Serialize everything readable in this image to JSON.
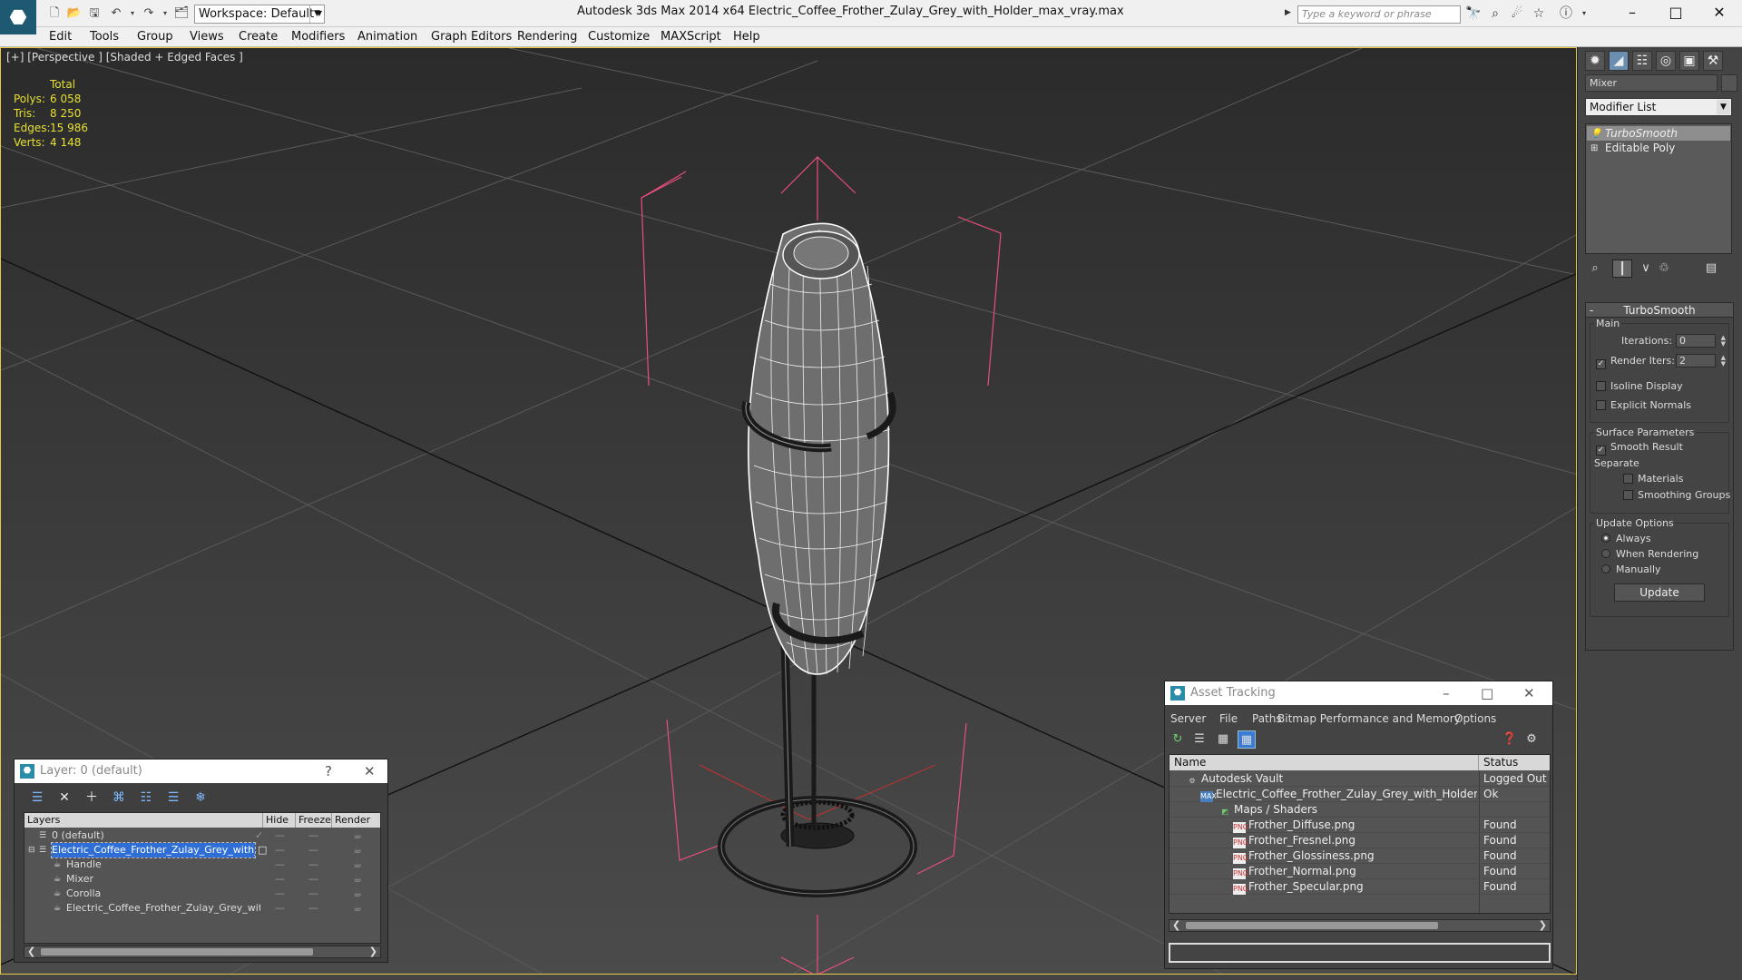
{
  "titlebar": {
    "app_icon": "3ds-max-logo-icon",
    "workspace": "Workspace: Default",
    "title": "Autodesk 3ds Max  2014 x64       Electric_Coffee_Frother_Zulay_Grey_with_Holder_max_vray.max",
    "search_placeholder": "Type a keyword or phrase"
  },
  "menu": [
    "Edit",
    "Tools",
    "Group",
    "Views",
    "Create",
    "Modifiers",
    "Animation",
    "Graph Editors",
    "Rendering",
    "Customize",
    "MAXScript",
    "Help"
  ],
  "viewport": {
    "label": "[+] [Perspective ] [Shaded + Edged Faces ]",
    "stats": {
      "header": "Total",
      "polys_label": "Polys:",
      "polys": "6 058",
      "tris_label": "Tris:",
      "tris": "8 250",
      "edges_label": "Edges:",
      "edges": "15 986",
      "verts_label": "Verts:",
      "verts": "4 148"
    }
  },
  "command_panel": {
    "object_name": "Mixer",
    "modifier_list": "Modifier List",
    "stack": [
      "TurboSmooth",
      "Editable Poly"
    ],
    "rollout_title": "TurboSmooth",
    "main_group": "Main",
    "iterations_label": "Iterations:",
    "iterations": "0",
    "render_iters_label": "Render Iters:",
    "render_iters": "2",
    "isoline": "Isoline Display",
    "explicit_normals": "Explicit Normals",
    "surface_group": "Surface Parameters",
    "smooth_result": "Smooth Result",
    "separate": "Separate",
    "materials": "Materials",
    "smoothing_groups": "Smoothing Groups",
    "update_group": "Update Options",
    "always": "Always",
    "when_rendering": "When Rendering",
    "manually": "Manually",
    "update_button": "Update"
  },
  "layer_window": {
    "title": "Layer: 0 (default)",
    "help": "?",
    "columns": [
      "Layers",
      "Hide",
      "Freeze",
      "Render"
    ],
    "rows": [
      {
        "name": "0 (default)",
        "indent": 1
      },
      {
        "name": "Electric_Coffee_Frother_Zulay_Grey_with_Holder",
        "indent": 1
      },
      {
        "name": "Handle",
        "indent": 2
      },
      {
        "name": "Mixer",
        "indent": 2
      },
      {
        "name": "Corolla",
        "indent": 2
      },
      {
        "name": "Electric_Coffee_Frother_Zulay_Grey_with_Holder",
        "indent": 2
      }
    ]
  },
  "asset_window": {
    "title": "Asset Tracking",
    "menu": [
      "Server",
      "File",
      "Paths",
      "Bitmap Performance and Memory",
      "Options"
    ],
    "columns": [
      "Name",
      "Status"
    ],
    "rows": [
      {
        "name": "Autodesk Vault",
        "status": "Logged Out ...",
        "indent": 0,
        "icon": "vault"
      },
      {
        "name": "Electric_Coffee_Frother_Zulay_Grey_with_Holder_max_vray.max",
        "status": "Ok",
        "indent": 1,
        "icon": "max"
      },
      {
        "name": "Maps / Shaders",
        "status": "",
        "indent": 2,
        "icon": "maps"
      },
      {
        "name": "Frother_Diffuse.png",
        "status": "Found",
        "indent": 3,
        "icon": "png"
      },
      {
        "name": "Frother_Fresnel.png",
        "status": "Found",
        "indent": 3,
        "icon": "png"
      },
      {
        "name": "Frother_Glossiness.png",
        "status": "Found",
        "indent": 3,
        "icon": "png"
      },
      {
        "name": "Frother_Normal.png",
        "status": "Found",
        "indent": 3,
        "icon": "png"
      },
      {
        "name": "Frother_Specular.png",
        "status": "Found",
        "indent": 3,
        "icon": "png"
      }
    ]
  },
  "colors": {
    "viewport_border": "#e8c94a",
    "stats": "#e6e032",
    "selection": "#2f6ed6",
    "bbox": "#e8507a"
  }
}
